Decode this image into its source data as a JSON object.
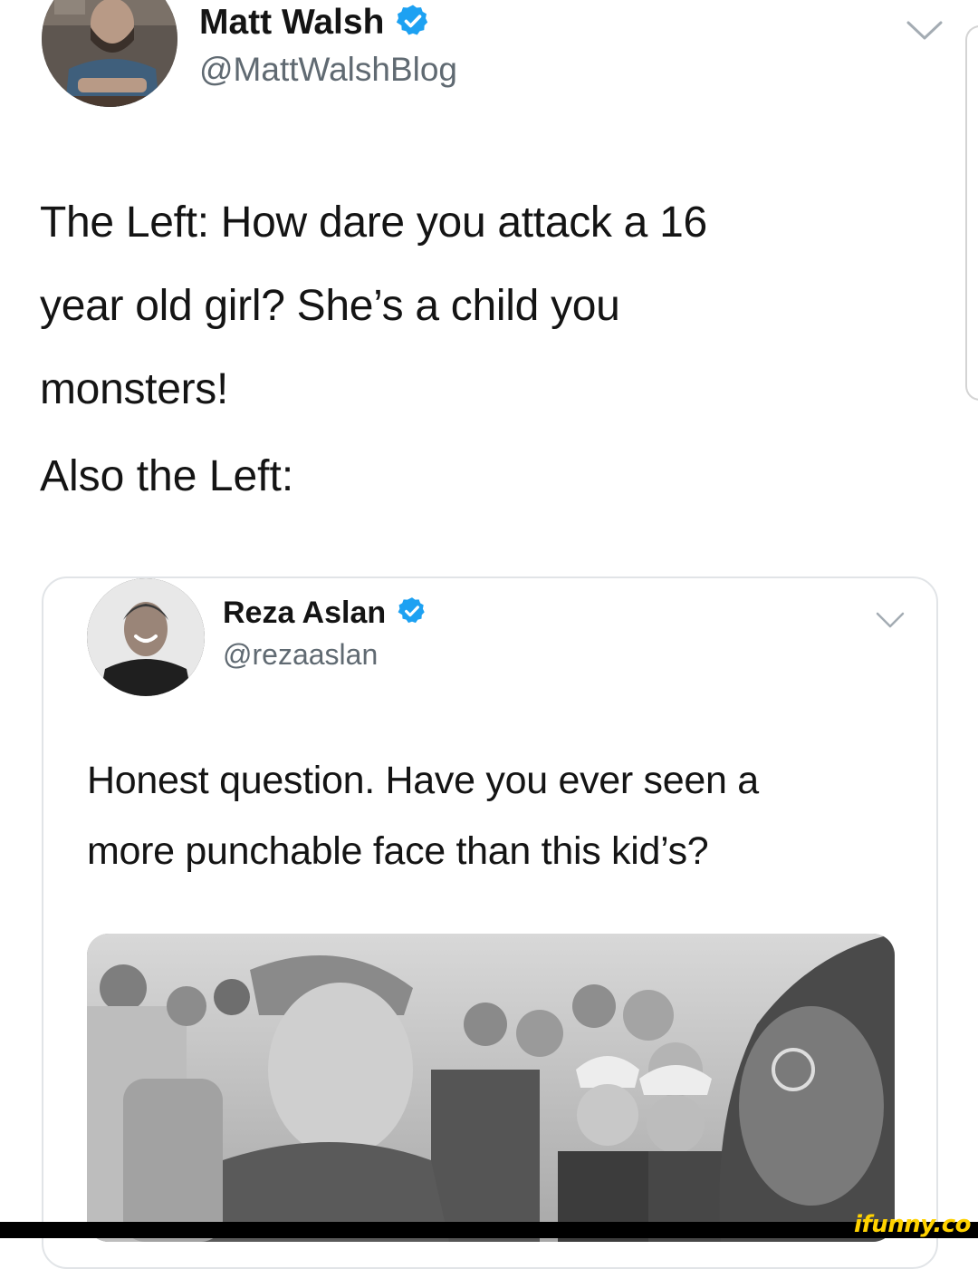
{
  "outer_tweet": {
    "author_name": "Matt Walsh",
    "handle": "@MattWalshBlog",
    "text_line_1": "The Left: How dare you attack a 16",
    "text_line_2": "year old girl? She’s a child you",
    "text_line_3": "monsters!",
    "text_line_4": "Also the Left:",
    "verified_icon": "verified-badge-icon",
    "menu_icon": "chevron-down-icon"
  },
  "quoted_tweet": {
    "author_name": "Reza Aslan",
    "handle": "@rezaaslan",
    "text_line_1": "Honest question. Have you ever seen a",
    "text_line_2": "more punchable face than this kid’s?",
    "verified_icon": "verified-badge-icon",
    "menu_icon": "chevron-down-icon",
    "photo_description_icon": "photo"
  },
  "watermark": {
    "text": "ifunny.co"
  },
  "colors": {
    "verified_blue": "#1da1f2",
    "handle_gray": "#606a72",
    "text_dark": "#141414",
    "card_border": "#e1e4e7",
    "watermark_yellow": "#ffd200",
    "bottom_bar": "#000000"
  }
}
